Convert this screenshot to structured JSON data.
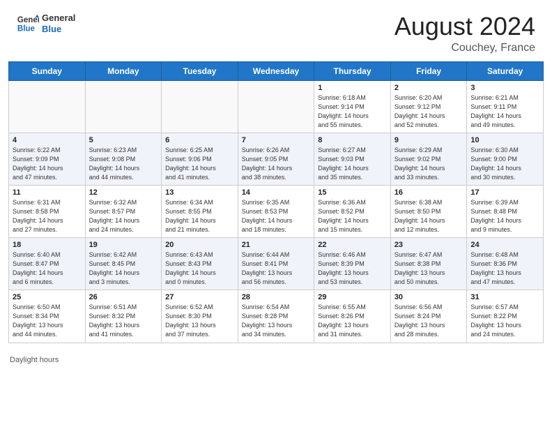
{
  "header": {
    "logo_line1": "General",
    "logo_line2": "Blue",
    "month_year": "August 2024",
    "location": "Couchey, France"
  },
  "days_of_week": [
    "Sunday",
    "Monday",
    "Tuesday",
    "Wednesday",
    "Thursday",
    "Friday",
    "Saturday"
  ],
  "weeks": [
    [
      {
        "num": "",
        "detail": ""
      },
      {
        "num": "",
        "detail": ""
      },
      {
        "num": "",
        "detail": ""
      },
      {
        "num": "",
        "detail": ""
      },
      {
        "num": "1",
        "detail": "Sunrise: 6:18 AM\nSunset: 9:14 PM\nDaylight: 14 hours\nand 55 minutes."
      },
      {
        "num": "2",
        "detail": "Sunrise: 6:20 AM\nSunset: 9:12 PM\nDaylight: 14 hours\nand 52 minutes."
      },
      {
        "num": "3",
        "detail": "Sunrise: 6:21 AM\nSunset: 9:11 PM\nDaylight: 14 hours\nand 49 minutes."
      }
    ],
    [
      {
        "num": "4",
        "detail": "Sunrise: 6:22 AM\nSunset: 9:09 PM\nDaylight: 14 hours\nand 47 minutes."
      },
      {
        "num": "5",
        "detail": "Sunrise: 6:23 AM\nSunset: 9:08 PM\nDaylight: 14 hours\nand 44 minutes."
      },
      {
        "num": "6",
        "detail": "Sunrise: 6:25 AM\nSunset: 9:06 PM\nDaylight: 14 hours\nand 41 minutes."
      },
      {
        "num": "7",
        "detail": "Sunrise: 6:26 AM\nSunset: 9:05 PM\nDaylight: 14 hours\nand 38 minutes."
      },
      {
        "num": "8",
        "detail": "Sunrise: 6:27 AM\nSunset: 9:03 PM\nDaylight: 14 hours\nand 35 minutes."
      },
      {
        "num": "9",
        "detail": "Sunrise: 6:29 AM\nSunset: 9:02 PM\nDaylight: 14 hours\nand 33 minutes."
      },
      {
        "num": "10",
        "detail": "Sunrise: 6:30 AM\nSunset: 9:00 PM\nDaylight: 14 hours\nand 30 minutes."
      }
    ],
    [
      {
        "num": "11",
        "detail": "Sunrise: 6:31 AM\nSunset: 8:58 PM\nDaylight: 14 hours\nand 27 minutes."
      },
      {
        "num": "12",
        "detail": "Sunrise: 6:32 AM\nSunset: 8:57 PM\nDaylight: 14 hours\nand 24 minutes."
      },
      {
        "num": "13",
        "detail": "Sunrise: 6:34 AM\nSunset: 8:55 PM\nDaylight: 14 hours\nand 21 minutes."
      },
      {
        "num": "14",
        "detail": "Sunrise: 6:35 AM\nSunset: 8:53 PM\nDaylight: 14 hours\nand 18 minutes."
      },
      {
        "num": "15",
        "detail": "Sunrise: 6:36 AM\nSunset: 8:52 PM\nDaylight: 14 hours\nand 15 minutes."
      },
      {
        "num": "16",
        "detail": "Sunrise: 6:38 AM\nSunset: 8:50 PM\nDaylight: 14 hours\nand 12 minutes."
      },
      {
        "num": "17",
        "detail": "Sunrise: 6:39 AM\nSunset: 8:48 PM\nDaylight: 14 hours\nand 9 minutes."
      }
    ],
    [
      {
        "num": "18",
        "detail": "Sunrise: 6:40 AM\nSunset: 8:47 PM\nDaylight: 14 hours\nand 6 minutes."
      },
      {
        "num": "19",
        "detail": "Sunrise: 6:42 AM\nSunset: 8:45 PM\nDaylight: 14 hours\nand 3 minutes."
      },
      {
        "num": "20",
        "detail": "Sunrise: 6:43 AM\nSunset: 8:43 PM\nDaylight: 14 hours\nand 0 minutes."
      },
      {
        "num": "21",
        "detail": "Sunrise: 6:44 AM\nSunset: 8:41 PM\nDaylight: 13 hours\nand 56 minutes."
      },
      {
        "num": "22",
        "detail": "Sunrise: 6:46 AM\nSunset: 8:39 PM\nDaylight: 13 hours\nand 53 minutes."
      },
      {
        "num": "23",
        "detail": "Sunrise: 6:47 AM\nSunset: 8:38 PM\nDaylight: 13 hours\nand 50 minutes."
      },
      {
        "num": "24",
        "detail": "Sunrise: 6:48 AM\nSunset: 8:36 PM\nDaylight: 13 hours\nand 47 minutes."
      }
    ],
    [
      {
        "num": "25",
        "detail": "Sunrise: 6:50 AM\nSunset: 8:34 PM\nDaylight: 13 hours\nand 44 minutes."
      },
      {
        "num": "26",
        "detail": "Sunrise: 6:51 AM\nSunset: 8:32 PM\nDaylight: 13 hours\nand 41 minutes."
      },
      {
        "num": "27",
        "detail": "Sunrise: 6:52 AM\nSunset: 8:30 PM\nDaylight: 13 hours\nand 37 minutes."
      },
      {
        "num": "28",
        "detail": "Sunrise: 6:54 AM\nSunset: 8:28 PM\nDaylight: 13 hours\nand 34 minutes."
      },
      {
        "num": "29",
        "detail": "Sunrise: 6:55 AM\nSunset: 8:26 PM\nDaylight: 13 hours\nand 31 minutes."
      },
      {
        "num": "30",
        "detail": "Sunrise: 6:56 AM\nSunset: 8:24 PM\nDaylight: 13 hours\nand 28 minutes."
      },
      {
        "num": "31",
        "detail": "Sunrise: 6:57 AM\nSunset: 8:22 PM\nDaylight: 13 hours\nand 24 minutes."
      }
    ]
  ],
  "footer": "Daylight hours"
}
